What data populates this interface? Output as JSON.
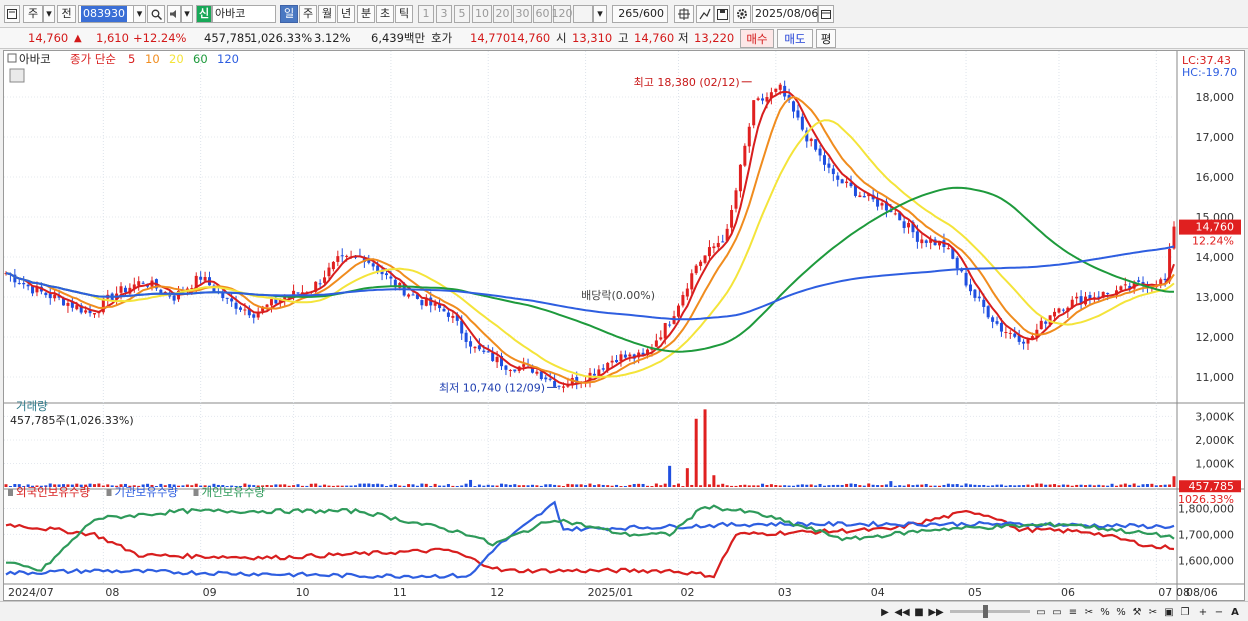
{
  "toolbar": {
    "period_label": "주",
    "prev_label": "전",
    "stock_code": "083930",
    "sin_badge": "신",
    "stock_name": "아바코",
    "tf_day": "일",
    "tf_week": "주",
    "tf_month": "월",
    "tf_year": "년",
    "tf_min": "분",
    "tf_sec": "초",
    "tf_tick": "틱",
    "nums": [
      "1",
      "3",
      "5",
      "10",
      "20",
      "30",
      "60",
      "120"
    ],
    "count_value": "265",
    "count_total": "/600",
    "date_value": "2025/08/06"
  },
  "quote": {
    "price": "14,760",
    "arrow": "▲",
    "change": "1,610",
    "change_pct": "+12.24%",
    "volume": "457,785",
    "volume_ratio": "1,026.33%",
    "turnover": "3.12%",
    "amount": "6,439백만",
    "bid_label": "호가",
    "bid1": "14,770",
    "bid2": "14,760",
    "open_label": "시",
    "open": "13,310",
    "high_label": "고",
    "high": "14,760",
    "low_label": "저",
    "low": "13,220",
    "buy_label": "매수",
    "sell_label": "매도",
    "eval_label": "평"
  },
  "chart_data": {
    "type": "candlestick",
    "legend": {
      "name": "아바코",
      "main": "종가 단순",
      "ma_periods": [
        "5",
        "10",
        "20",
        "60",
        "120"
      ],
      "ma_colors": [
        "#d81e1e",
        "#f08c1e",
        "#f4e43a",
        "#1e9a3c",
        "#2e5ee0"
      ]
    },
    "lc_label": "LC:37.43",
    "hc_label": "HC:-19.70",
    "y_ticks": [
      "18,000",
      "17,000",
      "16,000",
      "15,000",
      "14,000",
      "13,000",
      "12,000",
      "11,000"
    ],
    "y_tick_values": [
      18000,
      17000,
      16000,
      15000,
      14000,
      13000,
      12000,
      11000
    ],
    "ylim": [
      10400,
      18900
    ],
    "current_price_label": "14,760",
    "current_pct_label": "12.24%",
    "current_price": 14760,
    "high_annotation": "최고 18,380 (02/12)",
    "low_annotation": "최저 10,740 (12/09)",
    "dividend_annotation": "배당락(0.00%)",
    "x_labels": [
      "2024/07",
      "08",
      "09",
      "10",
      "11",
      "12",
      "2025/01",
      "02",
      "03",
      "04",
      "05",
      "06",
      "07",
      "08",
      "08/06"
    ],
    "close_path": [
      [
        0,
        13600
      ],
      [
        6,
        13200
      ],
      [
        13,
        12900
      ],
      [
        19,
        12600
      ],
      [
        25,
        13100
      ],
      [
        31,
        13400
      ],
      [
        38,
        13000
      ],
      [
        44,
        13500
      ],
      [
        50,
        12900
      ],
      [
        56,
        12600
      ],
      [
        63,
        13000
      ],
      [
        69,
        13200
      ],
      [
        75,
        13900
      ],
      [
        81,
        14000
      ],
      [
        88,
        13300
      ],
      [
        94,
        12900
      ],
      [
        100,
        12600
      ],
      [
        106,
        11700
      ],
      [
        113,
        11300
      ],
      [
        119,
        11200
      ],
      [
        125,
        10800
      ],
      [
        131,
        11000
      ],
      [
        138,
        11500
      ],
      [
        144,
        11500
      ],
      [
        150,
        12400
      ],
      [
        156,
        13800
      ],
      [
        163,
        14600
      ],
      [
        169,
        17800
      ],
      [
        175,
        18200
      ],
      [
        181,
        17000
      ],
      [
        187,
        16000
      ],
      [
        194,
        15500
      ],
      [
        200,
        15200
      ],
      [
        206,
        14500
      ],
      [
        212,
        14300
      ],
      [
        219,
        13000
      ],
      [
        225,
        12200
      ],
      [
        231,
        11900
      ],
      [
        237,
        12700
      ],
      [
        244,
        13000
      ],
      [
        250,
        13100
      ],
      [
        256,
        13300
      ],
      [
        262,
        13400
      ],
      [
        264,
        14760
      ]
    ],
    "volume_panel": {
      "title": "거래량",
      "value_label": "457,785주(1,026.33%)",
      "ticks": [
        "3,000K",
        "2,000K",
        "1,000K"
      ],
      "tick_values": [
        3000,
        2000,
        1000
      ],
      "ylim": [
        0,
        3400
      ],
      "last_volume_label": "457,785",
      "last_ratio_label": "1026.33%",
      "spikes": [
        [
          150,
          900
        ],
        [
          154,
          800
        ],
        [
          156,
          2900
        ],
        [
          158,
          3300
        ],
        [
          160,
          500
        ],
        [
          105,
          300
        ],
        [
          200,
          250
        ],
        [
          264,
          457
        ]
      ]
    },
    "holdings_panel": {
      "series_names": [
        "외국인보유수량",
        "기관보유수량",
        "개인보유수량"
      ],
      "series_colors": [
        "#d81e1e",
        "#2e5ee0",
        "#2e9a5a"
      ],
      "ticks": [
        "1,800,000",
        "1,700,000",
        "1,600,000"
      ],
      "tick_values": [
        1800000,
        1700000,
        1600000
      ],
      "ylim": [
        1520000,
        1860000
      ]
    }
  },
  "bottom": {
    "icons": [
      "play-icon",
      "rewind-icon",
      "stop-icon",
      "fastforward-icon"
    ]
  }
}
